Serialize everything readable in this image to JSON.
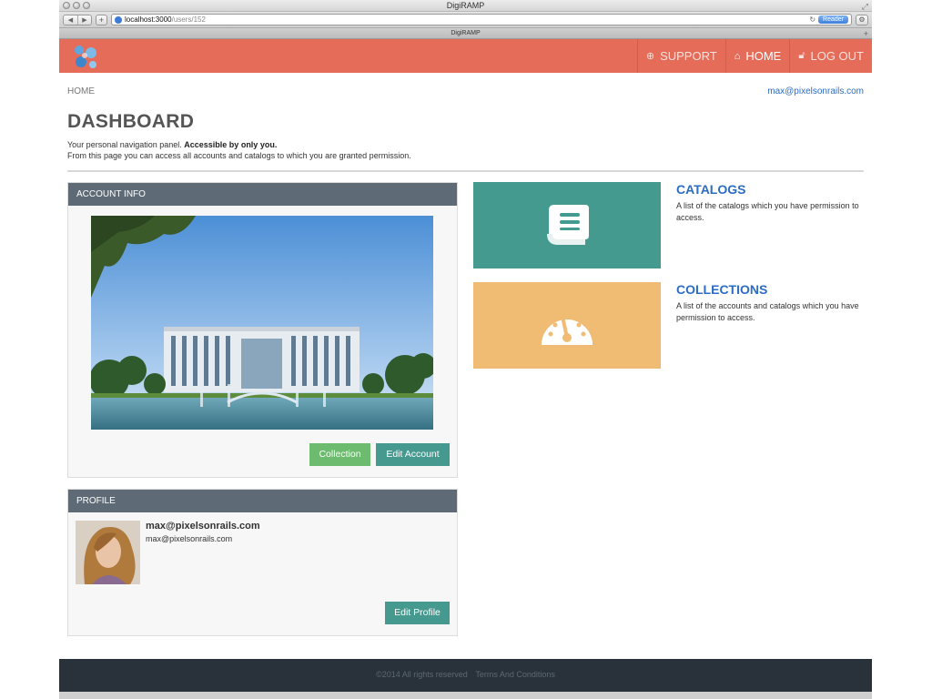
{
  "browser": {
    "title": "DigiRAMP",
    "url_host": "localhost:3000",
    "url_path": "/users/152",
    "reader_label": "Reader",
    "tab_title": "DigiRAMP"
  },
  "header": {
    "nav": [
      {
        "label": "SUPPORT",
        "icon": "lifebuoy-icon"
      },
      {
        "label": "HOME",
        "icon": "home-icon"
      },
      {
        "label": "LOG OUT",
        "icon": "unlock-icon"
      }
    ],
    "brand_color": "#e46c59"
  },
  "breadcrumb": {
    "home": "HOME"
  },
  "user_email": "max@pixelsonrails.com",
  "page": {
    "title": "DASHBOARD",
    "intro_line1": "Your personal navigation panel.",
    "intro_bold": "Accessible by only you.",
    "intro_line2": "From this page you can access all accounts and catalogs to which you are granted permission."
  },
  "account_info": {
    "heading": "ACCOUNT INFO",
    "collection_button": "Collection",
    "edit_account_button": "Edit Account"
  },
  "profile": {
    "heading": "PROFILE",
    "name": "max@pixelsonrails.com",
    "email": "max@pixelsonrails.com",
    "edit_profile_button": "Edit Profile"
  },
  "tiles": {
    "catalogs": {
      "title": "CATALOGS",
      "description": "A list of the catalogs which you have permission to access.",
      "color": "#449a8e",
      "icon": "book-icon"
    },
    "collections": {
      "title": "COLLECTIONS",
      "description": "A list of the accounts and catalogs which you have permission to access.",
      "color": "#f0bb72",
      "icon": "dashboard-gauge-icon"
    }
  },
  "footer": {
    "copyright": "©2014 All rights reserved",
    "terms": "Terms And Conditions"
  }
}
